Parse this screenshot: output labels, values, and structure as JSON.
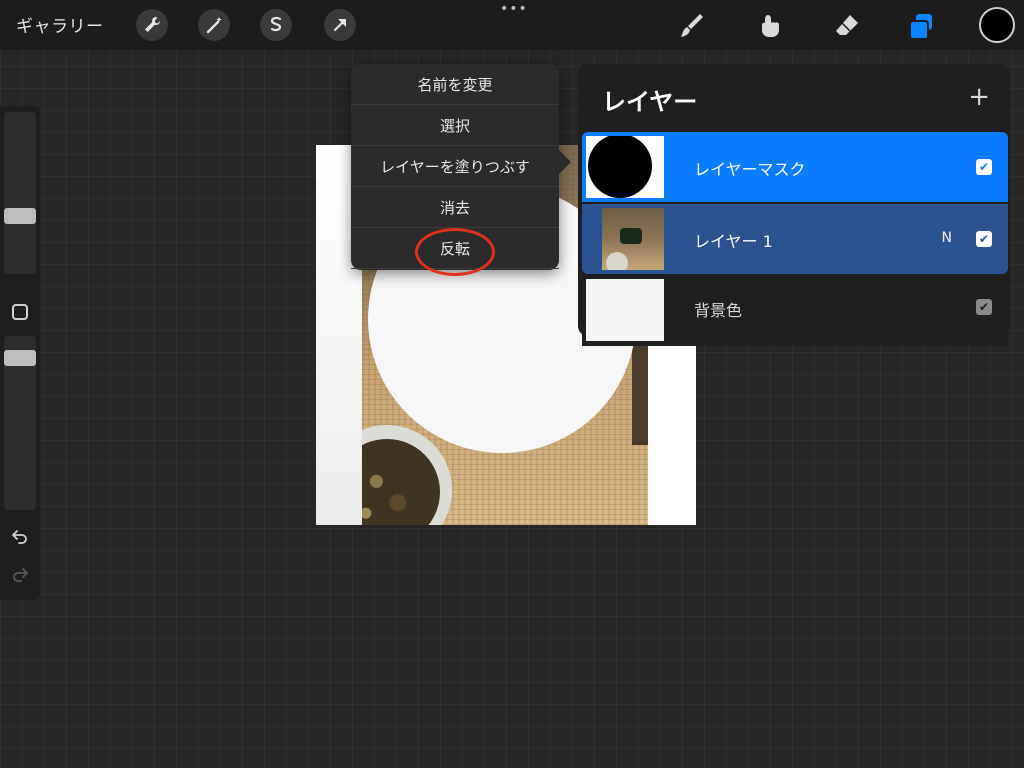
{
  "topbar": {
    "gallery_label": "ギャラリー",
    "more_dots": "•••",
    "tools_left": [
      "wrench-icon",
      "magic-wand-icon",
      "selection-icon",
      "transform-arrow-icon"
    ],
    "tools_right": [
      "brush-icon",
      "smudge-icon",
      "eraser-icon",
      "layers-icon"
    ],
    "current_color": "#000000",
    "accent_color": "#0a84ff"
  },
  "sidebar": {
    "brush_size_level": 0.64,
    "opacity_level": 0.84
  },
  "context_menu": {
    "items": [
      "名前を変更",
      "選択",
      "レイヤーを塗りつぶす",
      "消去",
      "反転"
    ],
    "highlighted_item": "反転"
  },
  "layers_panel": {
    "title": "レイヤー",
    "add_symbol": "+",
    "layers": [
      {
        "name": "レイヤーマスク",
        "mode": "",
        "checked": true,
        "state": "selected"
      },
      {
        "name": "レイヤー 1",
        "mode": "N",
        "checked": true,
        "state": "parent"
      },
      {
        "name": "背景色",
        "mode": "",
        "checked": true,
        "state": "normal"
      }
    ],
    "colors": {
      "selected": "#0a7cff",
      "parent": "#2a5491",
      "normal": "#1f1f1f"
    }
  }
}
